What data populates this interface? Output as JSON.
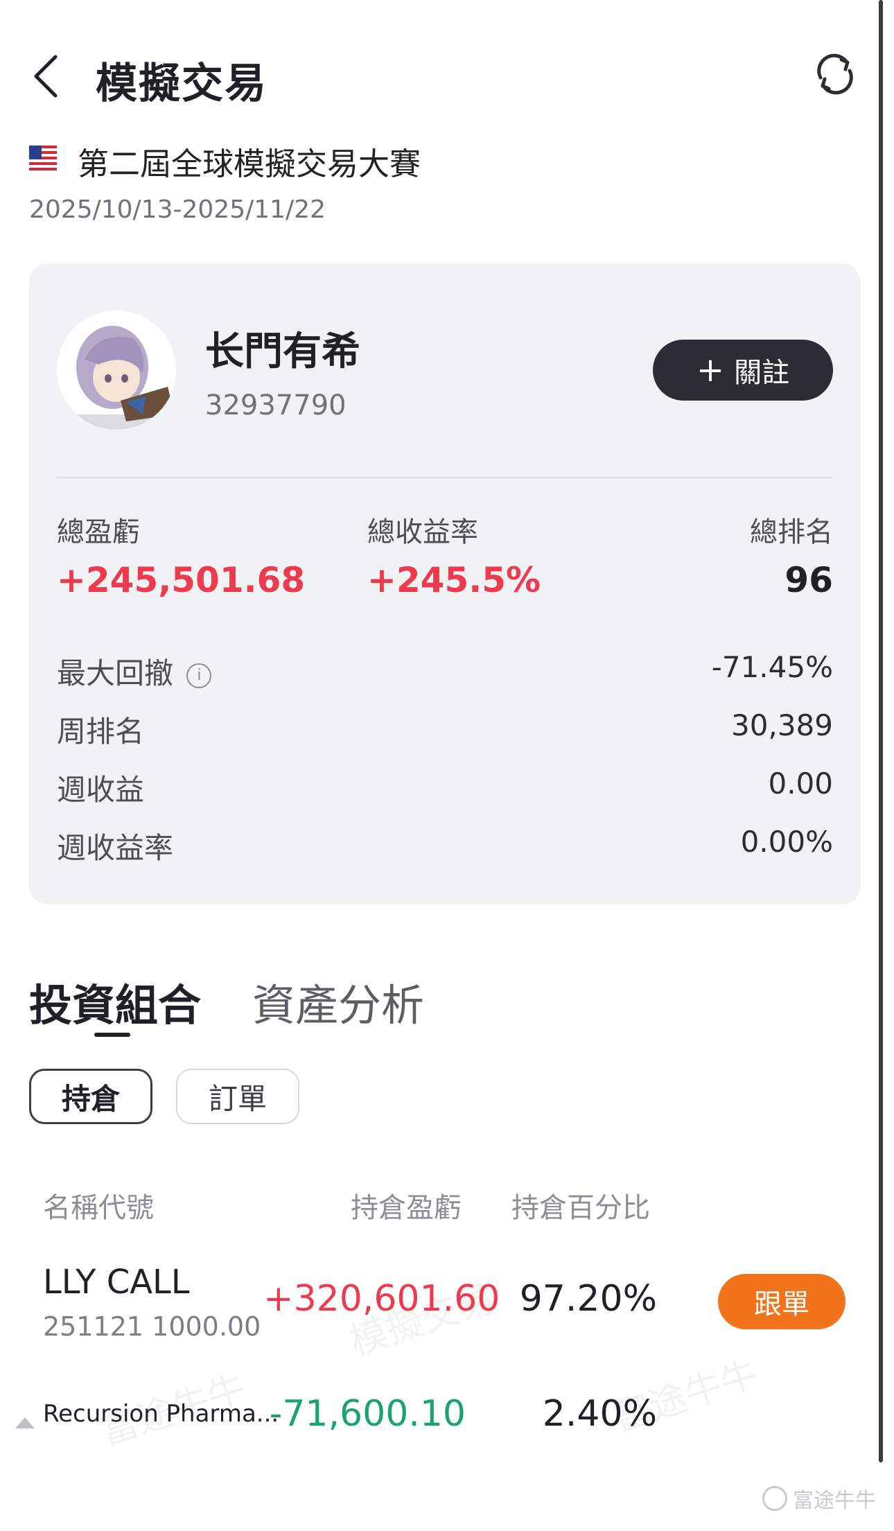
{
  "header": {
    "title": "模擬交易"
  },
  "contest": {
    "title": "第二屆全球模擬交易大賽",
    "dates": "2025/10/13-2025/11/22",
    "flag": "us-flag-icon"
  },
  "profile": {
    "name": "长門有希",
    "id": "32937790",
    "follow_label": "關註"
  },
  "stats": {
    "total_pl_label": "總盈虧",
    "total_pl_value": "+245,501.68",
    "total_return_label": "總收益率",
    "total_return_value": "+245.5%",
    "total_rank_label": "總排名",
    "total_rank_value": "96"
  },
  "details": {
    "max_drawdown_label": "最大回撤",
    "max_drawdown_value": "-71.45%",
    "week_rank_label": "周排名",
    "week_rank_value": "30,389",
    "week_pl_label": "週收益",
    "week_pl_value": "0.00",
    "week_return_label": "週收益率",
    "week_return_value": "0.00%"
  },
  "tabs": {
    "portfolio": "投資組合",
    "analysis": "資產分析"
  },
  "subtabs": {
    "holdings": "持倉",
    "orders": "訂單"
  },
  "table": {
    "col_name": "名稱代號",
    "col_pl": "持倉盈虧",
    "col_pct": "持倉百分比",
    "rows": [
      {
        "name": "LLY CALL",
        "sub": "251121 1000.00",
        "pl": "+320,601.60",
        "pct": "97.20%",
        "action": "跟單"
      },
      {
        "name": "Recursion Pharma...",
        "sub": "",
        "pl": "-71,600.10",
        "pct": "2.40%"
      }
    ]
  },
  "watermarks": {
    "app": "富途牛牛",
    "mode": "模擬交易"
  },
  "colors": {
    "gain": "#ee3a4e",
    "loss": "#1aa36c",
    "accent": "#f2741a",
    "dark_button": "#2a2d33",
    "card_bg": "#f1f2f4"
  }
}
